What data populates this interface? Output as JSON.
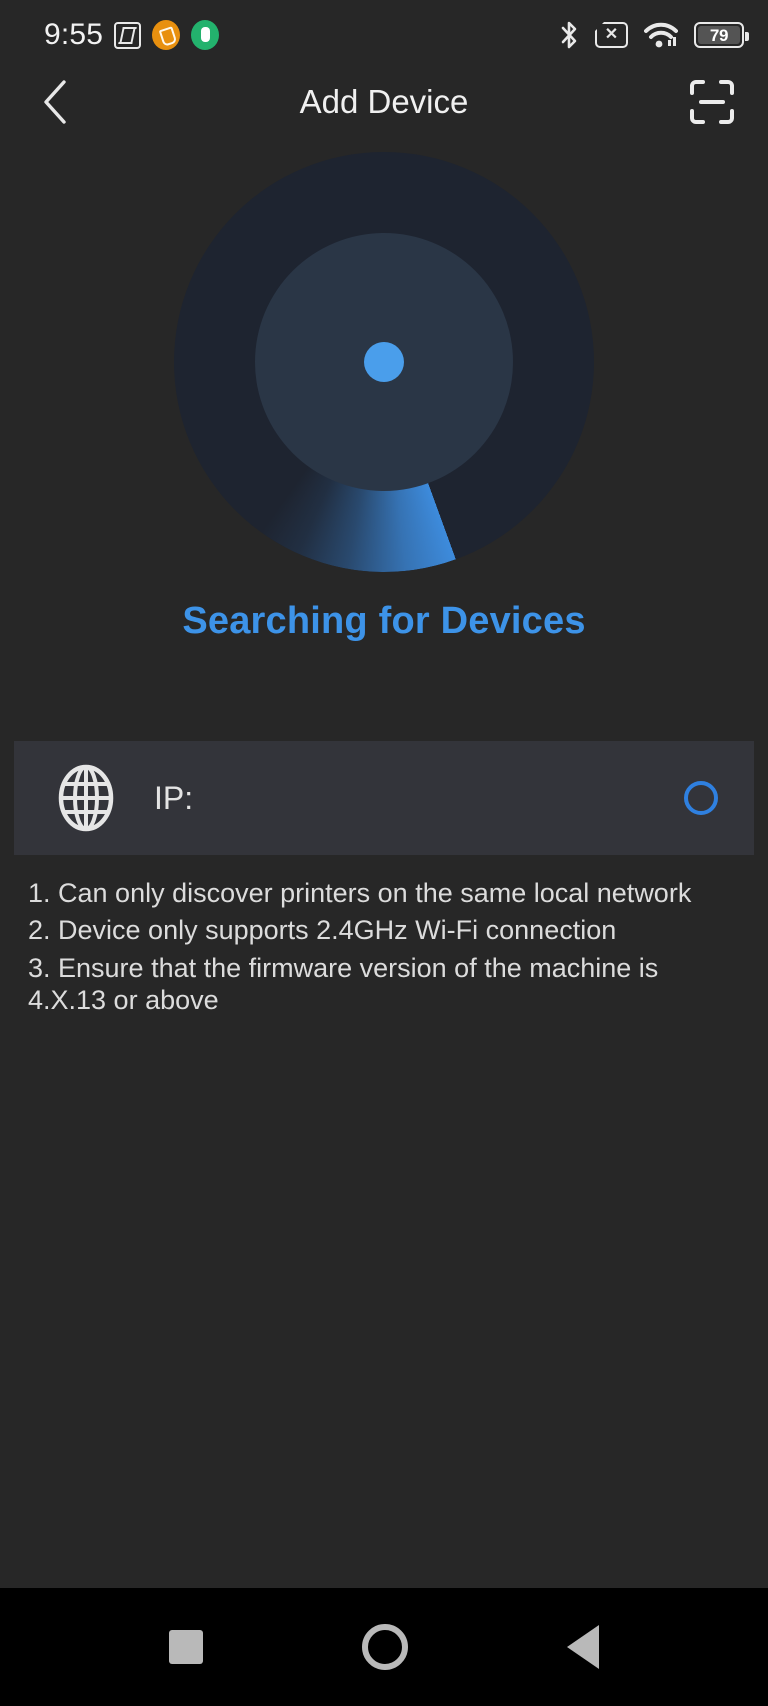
{
  "status_bar": {
    "time": "9:55",
    "battery_percent": "79",
    "left_icons": [
      "nfc-icon",
      "orange-badge-icon",
      "green-shield-icon"
    ],
    "right_icons": [
      "bluetooth-icon",
      "no-sim-icon",
      "wifi-icon",
      "battery-icon"
    ]
  },
  "app_bar": {
    "title": "Add Device",
    "back_icon": "chevron-left-icon",
    "scan_icon": "qr-scan-icon"
  },
  "radar": {
    "center_dot_color": "#4a9eeb",
    "sweep_color": "#3f91e6",
    "outer_color": "#1e2430",
    "inner_color": "#2a3646"
  },
  "main": {
    "searching_label": "Searching for Devices",
    "searching_color": "#3d93e8"
  },
  "ip_card": {
    "icon": "globe-icon",
    "label": "IP:",
    "spinner": "loading-ring",
    "spinner_color": "#2f80e0"
  },
  "notes": {
    "line1": "1. Can only discover printers on the same local network",
    "line2": "2. Device only supports 2.4GHz Wi-Fi connection",
    "line3": "3. Ensure that the firmware version of the machine is 4.X.13 or above"
  },
  "nav_bar": {
    "recents": "recents-square-icon",
    "home": "home-circle-icon",
    "back": "back-triangle-icon"
  }
}
